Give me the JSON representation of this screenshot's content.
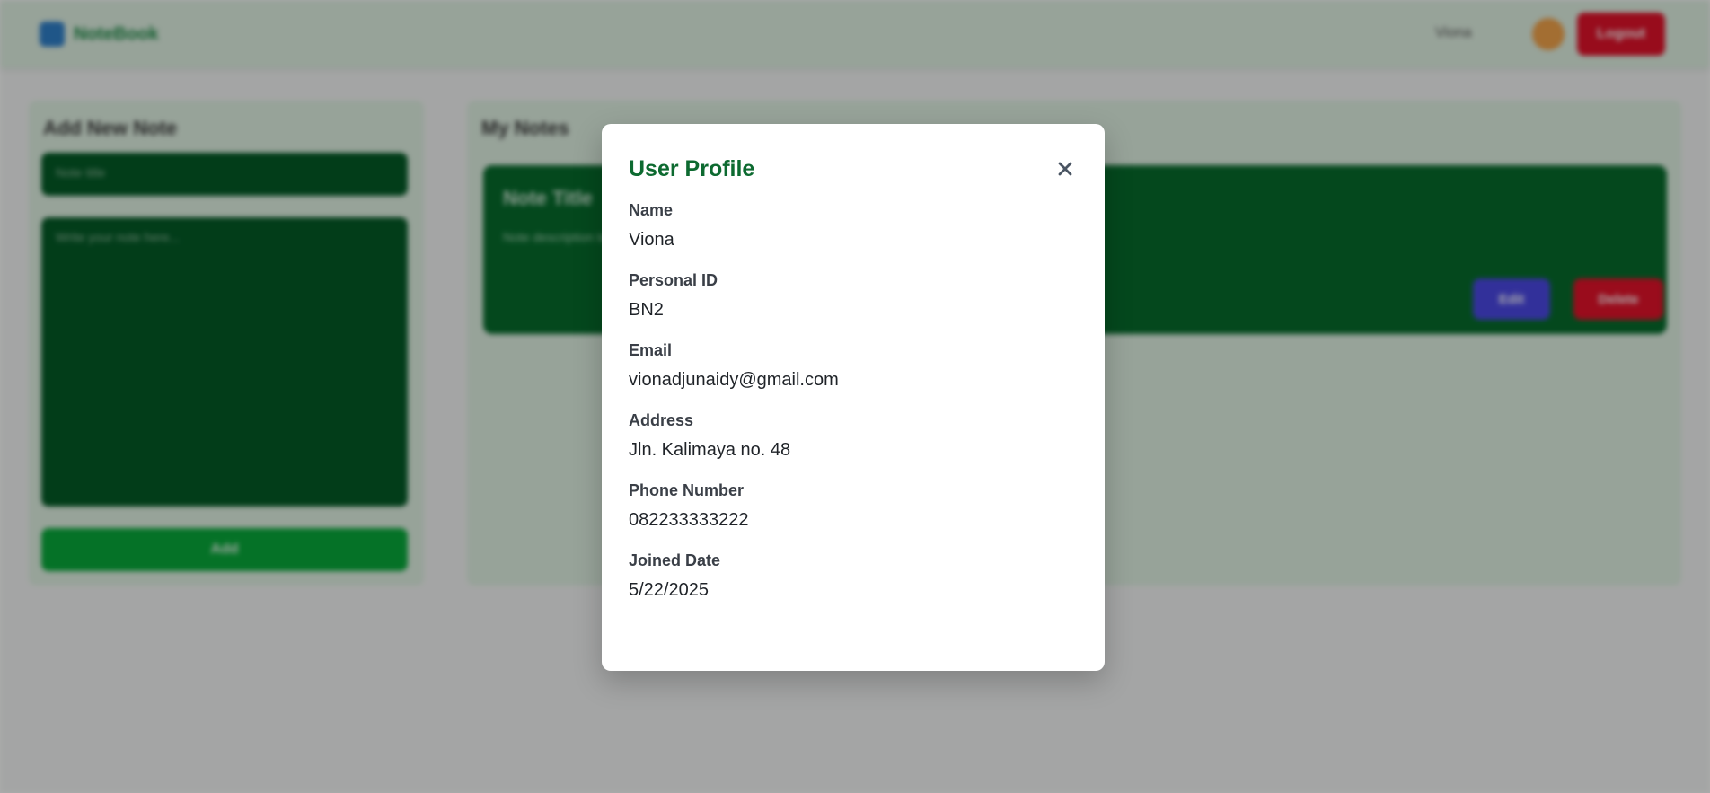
{
  "app": {
    "brand_name": "NoteBook",
    "nav": {
      "user_name": "Viona",
      "logout_label": "Logout"
    }
  },
  "left_panel": {
    "title": "Add New Note",
    "title_placeholder": "Note title",
    "content_placeholder": "Write your note here...",
    "submit_label": "Add"
  },
  "right_panel": {
    "title": "My Notes",
    "note": {
      "title": "Note Title",
      "body": "Note description text",
      "edit_label": "Edit",
      "delete_label": "Delete"
    }
  },
  "modal": {
    "title": "User Profile",
    "close_icon": "close-icon",
    "fields": [
      {
        "label": "Name",
        "value": "Viona"
      },
      {
        "label": "Personal ID",
        "value": "BN2"
      },
      {
        "label": "Email",
        "value": "vionadjunaidy@gmail.com"
      },
      {
        "label": "Address",
        "value": "Jln. Kalimaya no. 48"
      },
      {
        "label": "Phone Number",
        "value": "082233333222"
      },
      {
        "label": "Joined Date",
        "value": "5/22/2025"
      }
    ]
  },
  "colors": {
    "accent_green": "#0d6a30",
    "logout_red": "#e0122a",
    "edit_blue": "#4b48e4"
  }
}
